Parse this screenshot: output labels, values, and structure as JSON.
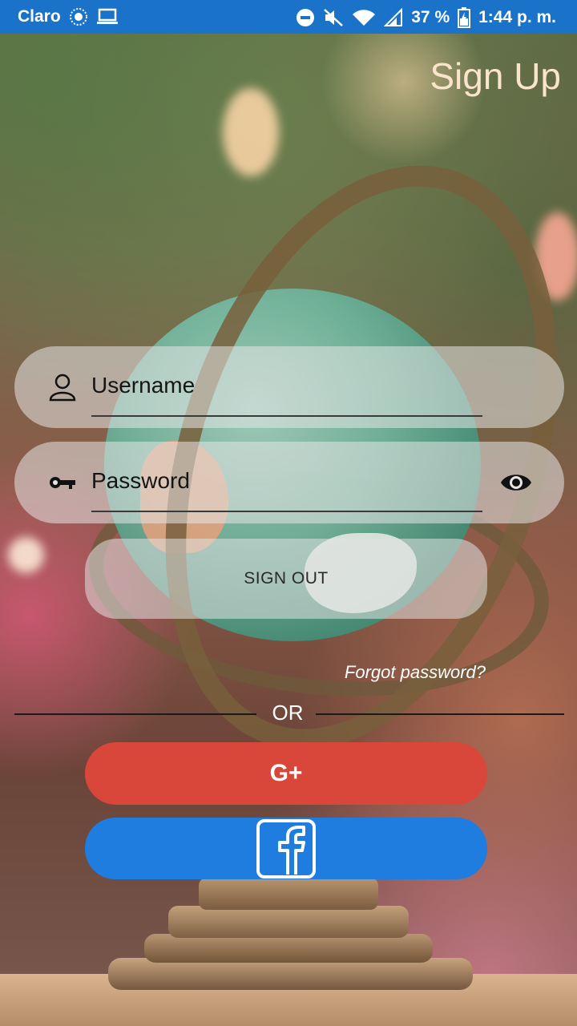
{
  "status_bar": {
    "carrier": "Claro",
    "battery": "37 %",
    "time": "1:44 p. m.",
    "color": "#1a73c9"
  },
  "title": "Sign Up",
  "username": {
    "placeholder": "Username",
    "icon": "person-icon"
  },
  "password": {
    "placeholder": "Password",
    "icon": "key-icon",
    "toggle_icon": "eye-icon"
  },
  "buttons": {
    "signout": "SIGN OUT",
    "google": "G+",
    "google_color": "#d9473a",
    "facebook_icon": "facebook-icon",
    "facebook_color": "#1f7de0"
  },
  "forgot": "Forgot password?",
  "or": "OR"
}
